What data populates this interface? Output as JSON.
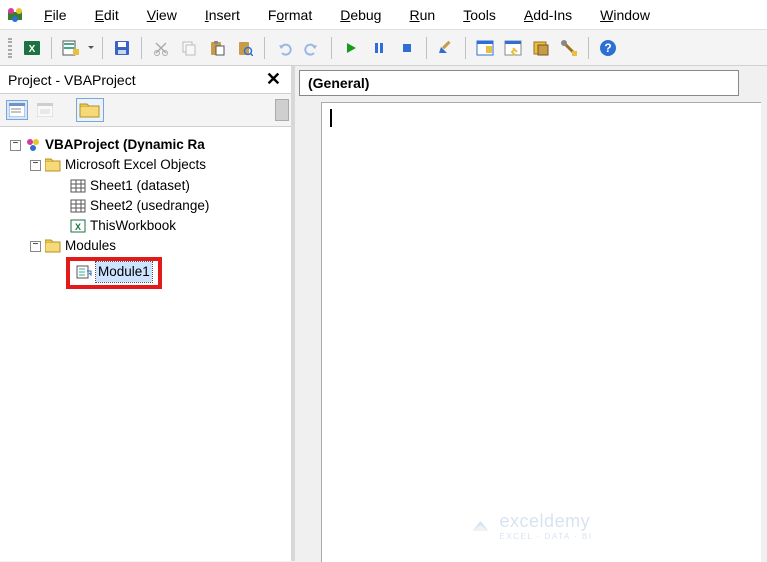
{
  "menu": {
    "items": [
      {
        "hotkey": "F",
        "rest": "ile"
      },
      {
        "hotkey": "E",
        "rest": "dit"
      },
      {
        "hotkey": "V",
        "rest": "iew"
      },
      {
        "hotkey": "I",
        "rest": "nsert"
      },
      {
        "hotkey": "o",
        "pre": "F",
        "rest": "rmat"
      },
      {
        "hotkey": "D",
        "rest": "ebug"
      },
      {
        "hotkey": "R",
        "rest": "un"
      },
      {
        "hotkey": "T",
        "rest": "ools"
      },
      {
        "hotkey": "A",
        "rest": "dd-Ins"
      },
      {
        "hotkey": "W",
        "rest": "indow"
      }
    ]
  },
  "project_pane": {
    "title": "Project - VBAProject",
    "root": "VBAProject (Dynamic Ra",
    "folder_objects": "Microsoft Excel Objects",
    "sheet1": "Sheet1 (dataset)",
    "sheet2": "Sheet2 (usedrange)",
    "thiswb": "ThisWorkbook",
    "folder_modules": "Modules",
    "module1": "Module1"
  },
  "code_pane": {
    "procedure_dropdown": "(General)"
  },
  "watermark": {
    "brand": "exceldemy",
    "tagline": "EXCEL · DATA · BI"
  }
}
